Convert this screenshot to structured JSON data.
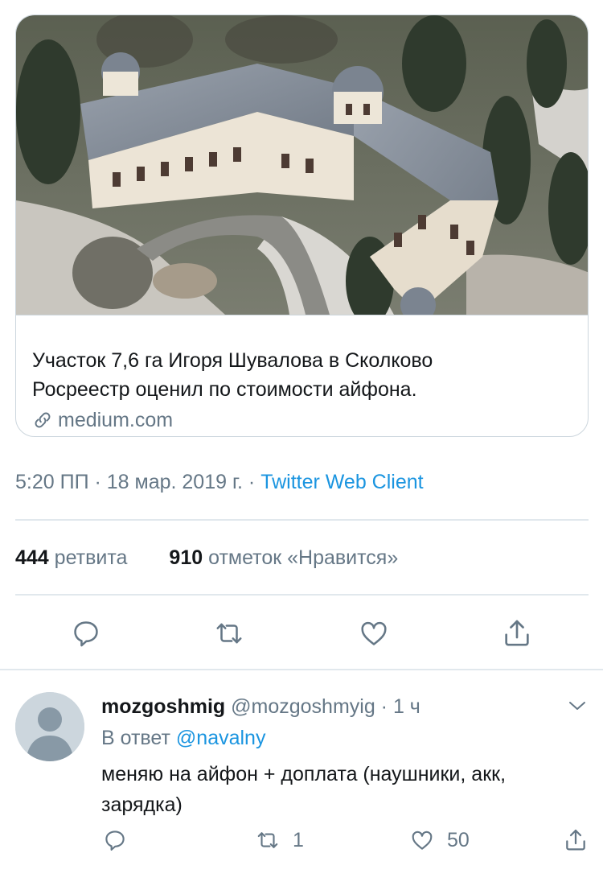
{
  "link_card": {
    "image_alt": "aerial photo of mansion in snowy forest",
    "title_lines": [
      "Участок 7,6 га Игоря Шувалова в Сколково",
      "Росреестр оценил по стоимости айфона."
    ],
    "domain": "medium.com"
  },
  "tweet_meta": {
    "time": "5:20 ПП",
    "separator": " · ",
    "date": "18 мар. 2019 г.",
    "client": "Twitter Web Client"
  },
  "stats": {
    "retweets_count": "444",
    "retweets_label": "ретвита",
    "likes_count": "910",
    "likes_label": "отметок «Нравится»"
  },
  "actions": {
    "icons": [
      "reply-icon",
      "retweet-icon",
      "like-icon",
      "share-icon"
    ]
  },
  "reply": {
    "display_name": "mozgoshmig",
    "handle": "@mozgoshmyig",
    "dot": " · ",
    "time_ago": "1 ч",
    "reply_to_label": "В ответ",
    "reply_to_mention": "@navalny",
    "text_lines": [
      "меняю на айфон + доплата (наушники, акк,",
      "зарядка)"
    ],
    "retweet_count": "1",
    "like_count": "50"
  },
  "colors": {
    "link": "#1b95e0",
    "secondary": "#657786",
    "border": "#ccd6dd"
  }
}
